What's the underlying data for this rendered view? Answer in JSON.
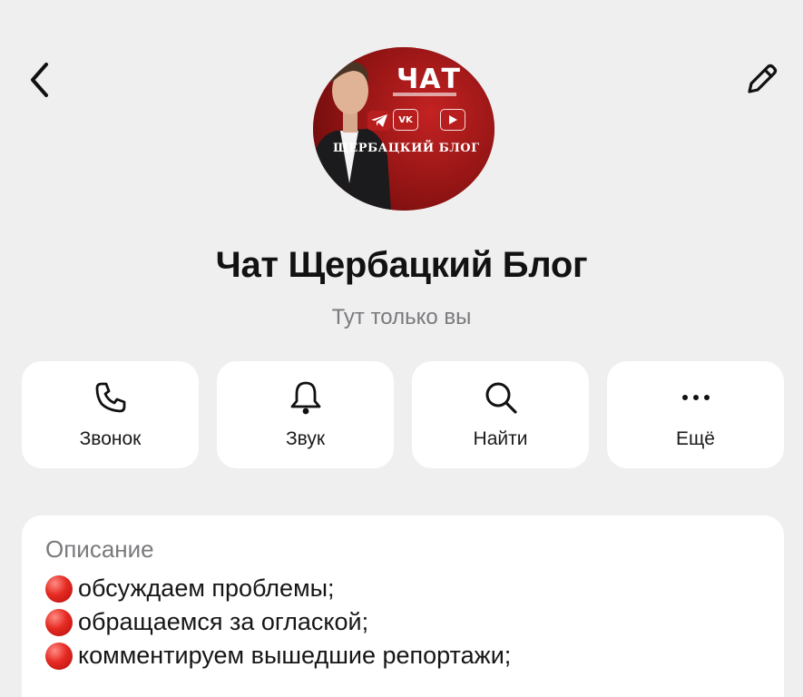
{
  "header": {
    "back_icon": "chevron-left-icon",
    "edit_icon": "pencil-icon"
  },
  "avatar": {
    "chat_text": "ЧАТ",
    "blog_text": "ЩЕРБАЦКИЙ БЛОГ",
    "icons": [
      "telegram-icon",
      "vk-icon",
      "youtube-icon"
    ],
    "brand_color": "#a51616"
  },
  "profile": {
    "title": "Чат Щербацкий Блог",
    "subtitle": "Тут только вы"
  },
  "actions": [
    {
      "label": "Звонок",
      "icon": "phone-icon"
    },
    {
      "label": "Звук",
      "icon": "bell-icon"
    },
    {
      "label": "Найти",
      "icon": "search-icon"
    },
    {
      "label": "Ещё",
      "icon": "more-icon"
    }
  ],
  "description": {
    "title": "Описание",
    "lines": [
      " обсуждаем проблемы;",
      "обращаемся за оглаской;",
      "комментируем вышедшие репортажи;"
    ],
    "bullet_color": "#e52a22"
  }
}
